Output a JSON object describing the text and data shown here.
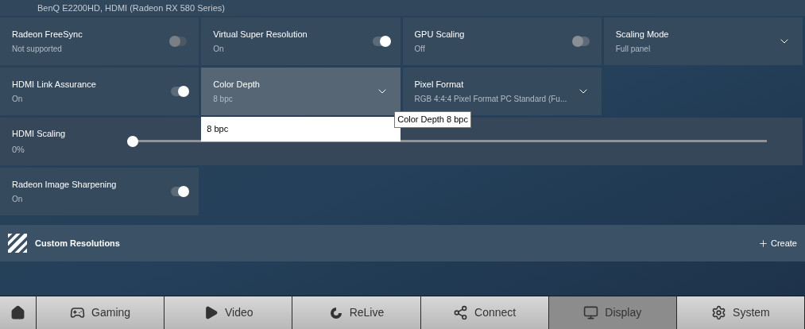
{
  "header": {
    "device": "BenQ E2200HD, HDMI (Radeon RX 580 Series)"
  },
  "settings": [
    {
      "kind": "toggle",
      "label": "Radeon FreeSync",
      "value": "Not supported",
      "on": false,
      "disabled": true
    },
    {
      "kind": "toggle",
      "label": "Virtual Super Resolution",
      "value": "On",
      "on": true,
      "disabled": false
    },
    {
      "kind": "toggle",
      "label": "GPU Scaling",
      "value": "Off",
      "on": false,
      "disabled": false
    },
    {
      "kind": "dropdown",
      "label": "Scaling Mode",
      "value": "Full panel",
      "expanded": false
    },
    {
      "kind": "toggle",
      "label": "HDMI Link Assurance",
      "value": "On",
      "on": true,
      "disabled": false
    },
    {
      "kind": "dropdown",
      "label": "Color Depth",
      "value": "8 bpc",
      "expanded": true,
      "options": [
        "8 bpc"
      ],
      "tooltip": "Color Depth 8 bpc"
    },
    {
      "kind": "dropdown",
      "label": "Pixel Format",
      "value": "RGB 4:4:4 Pixel Format PC Standard (Fu...",
      "expanded": false
    },
    {
      "kind": "slider",
      "label": "HDMI Scaling",
      "value": "0%",
      "level": 0
    },
    {
      "kind": "toggle",
      "label": "Radeon Image Sharpening",
      "value": "On",
      "on": true,
      "disabled": false
    }
  ],
  "custom_resolutions": {
    "title": "Custom Resolutions",
    "action": "Create"
  },
  "nav": [
    {
      "kind": "home",
      "selected": false
    },
    {
      "kind": "gaming",
      "label": "Gaming",
      "selected": false
    },
    {
      "kind": "video",
      "label": "Video",
      "selected": false
    },
    {
      "kind": "relive",
      "label": "ReLive",
      "selected": false
    },
    {
      "kind": "connect",
      "label": "Connect",
      "selected": false
    },
    {
      "kind": "display",
      "label": "Display",
      "selected": true
    },
    {
      "kind": "system",
      "label": "System",
      "selected": false
    }
  ]
}
